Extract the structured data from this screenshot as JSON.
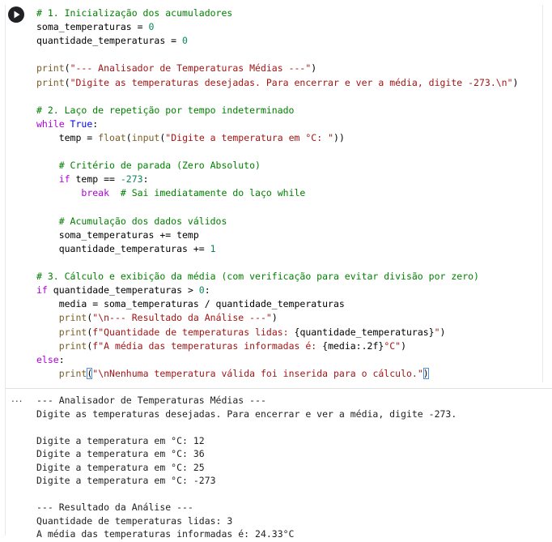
{
  "cell": {
    "run_button_label": "Run cell",
    "output_menu_label": "..."
  },
  "code_lines": [
    [
      {
        "t": "# 1. Inicialização dos acumuladores",
        "c": "comment"
      }
    ],
    [
      {
        "t": "soma_temperaturas = ",
        "c": "op"
      },
      {
        "t": "0",
        "c": "number"
      }
    ],
    [
      {
        "t": "quantidade_temperaturas = ",
        "c": "op"
      },
      {
        "t": "0",
        "c": "number"
      }
    ],
    [],
    [
      {
        "t": "print",
        "c": "builtin"
      },
      {
        "t": "(",
        "c": "op"
      },
      {
        "t": "\"--- Analisador de Temperaturas Médias ---\"",
        "c": "string"
      },
      {
        "t": ")",
        "c": "op"
      }
    ],
    [
      {
        "t": "print",
        "c": "builtin"
      },
      {
        "t": "(",
        "c": "op"
      },
      {
        "t": "\"Digite as temperaturas desejadas. Para encerrar e ver a média, digite -273.\\n\"",
        "c": "string"
      },
      {
        "t": ")",
        "c": "op"
      }
    ],
    [],
    [
      {
        "t": "# 2. Laço de repetição por tempo indeterminado",
        "c": "comment"
      }
    ],
    [
      {
        "t": "while ",
        "c": "keyword"
      },
      {
        "t": "True",
        "c": "bool"
      },
      {
        "t": ":",
        "c": "op"
      }
    ],
    [
      {
        "t": "    temp = ",
        "c": "op"
      },
      {
        "t": "float",
        "c": "builtin"
      },
      {
        "t": "(",
        "c": "op"
      },
      {
        "t": "input",
        "c": "builtin"
      },
      {
        "t": "(",
        "c": "op"
      },
      {
        "t": "\"Digite a temperatura em °C: \"",
        "c": "string"
      },
      {
        "t": "))",
        "c": "op"
      }
    ],
    [],
    [
      {
        "t": "    # Critério de parada (Zero Absoluto)",
        "c": "comment"
      }
    ],
    [
      {
        "t": "    ",
        "c": "op"
      },
      {
        "t": "if",
        "c": "keyword"
      },
      {
        "t": " temp == ",
        "c": "op"
      },
      {
        "t": "-273",
        "c": "number"
      },
      {
        "t": ":",
        "c": "op"
      }
    ],
    [
      {
        "t": "        ",
        "c": "op"
      },
      {
        "t": "break",
        "c": "keyword"
      },
      {
        "t": "  # Sai imediatamente do laço while",
        "c": "comment"
      }
    ],
    [],
    [
      {
        "t": "    # Acumulação dos dados válidos",
        "c": "comment"
      }
    ],
    [
      {
        "t": "    soma_temperaturas += temp",
        "c": "op"
      }
    ],
    [
      {
        "t": "    quantidade_temperaturas += ",
        "c": "op"
      },
      {
        "t": "1",
        "c": "number"
      }
    ],
    [],
    [
      {
        "t": "# 3. Cálculo e exibição da média (com verificação para evitar divisão por zero)",
        "c": "comment"
      }
    ],
    [
      {
        "t": "if",
        "c": "keyword"
      },
      {
        "t": " quantidade_temperaturas > ",
        "c": "op"
      },
      {
        "t": "0",
        "c": "number"
      },
      {
        "t": ":",
        "c": "op"
      }
    ],
    [
      {
        "t": "    media = soma_temperaturas / quantidade_temperaturas",
        "c": "op"
      }
    ],
    [
      {
        "t": "    ",
        "c": "op"
      },
      {
        "t": "print",
        "c": "builtin"
      },
      {
        "t": "(",
        "c": "op"
      },
      {
        "t": "\"\\n--- Resultado da Análise ---\"",
        "c": "string"
      },
      {
        "t": ")",
        "c": "op"
      }
    ],
    [
      {
        "t": "    ",
        "c": "op"
      },
      {
        "t": "print",
        "c": "builtin"
      },
      {
        "t": "(",
        "c": "op"
      },
      {
        "t": "f\"Quantidade de temperaturas lidas: ",
        "c": "string"
      },
      {
        "t": "{quantidade_temperaturas}",
        "c": "op"
      },
      {
        "t": "\"",
        "c": "string"
      },
      {
        "t": ")",
        "c": "op"
      }
    ],
    [
      {
        "t": "    ",
        "c": "op"
      },
      {
        "t": "print",
        "c": "builtin"
      },
      {
        "t": "(",
        "c": "op"
      },
      {
        "t": "f\"A média das temperaturas informadas é: ",
        "c": "string"
      },
      {
        "t": "{media:.2f}",
        "c": "op"
      },
      {
        "t": "°C\"",
        "c": "string"
      },
      {
        "t": ")",
        "c": "op"
      }
    ],
    [
      {
        "t": "else",
        "c": "keyword"
      },
      {
        "t": ":",
        "c": "op"
      }
    ],
    [
      {
        "t": "    ",
        "c": "op"
      },
      {
        "t": "print",
        "c": "builtin"
      },
      {
        "t": "(",
        "c": "bracket"
      },
      {
        "t": "\"\\nNenhuma temperatura válida foi inserida para o cálculo.\"",
        "c": "string"
      },
      {
        "t": ")",
        "c": "bracket"
      }
    ]
  ],
  "output_lines": [
    "--- Analisador de Temperaturas Médias ---",
    "Digite as temperaturas desejadas. Para encerrar e ver a média, digite -273.",
    "",
    "Digite a temperatura em °C: 12",
    "Digite a temperatura em °C: 36",
    "Digite a temperatura em °C: 25",
    "Digite a temperatura em °C: -273",
    "",
    "--- Resultado da Análise ---",
    "Quantidade de temperaturas lidas: 3",
    "A média das temperaturas informadas é: 24.33°C"
  ]
}
